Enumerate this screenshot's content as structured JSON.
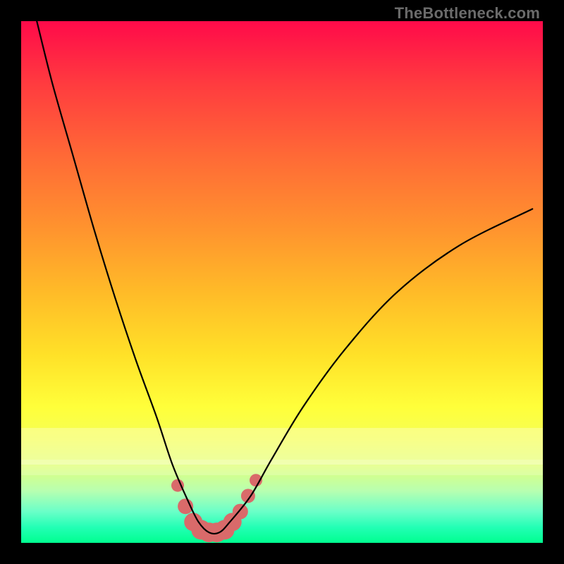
{
  "watermark": "TheBottleneck.com",
  "chart_data": {
    "type": "line",
    "title": "",
    "xlabel": "",
    "ylabel": "",
    "xlim": [
      0,
      100
    ],
    "ylim": [
      0,
      100
    ],
    "series": [
      {
        "name": "bottleneck-curve",
        "x": [
          3,
          6,
          10,
          14,
          18,
          22,
          26,
          29,
          32,
          34,
          36,
          38,
          40,
          44,
          48,
          54,
          62,
          72,
          84,
          98
        ],
        "y": [
          100,
          88,
          74,
          60,
          47,
          35,
          24,
          15,
          8,
          4,
          2,
          2,
          4,
          9,
          16,
          26,
          37,
          48,
          57,
          64
        ]
      }
    ],
    "markers": {
      "name": "highlight-points",
      "x": [
        30,
        31.5,
        33,
        34.5,
        36,
        37.5,
        39,
        40.5,
        42,
        43.5,
        45
      ],
      "y": [
        11,
        7,
        4,
        2.5,
        2,
        2,
        2.5,
        4,
        6,
        9,
        12
      ],
      "size": [
        9,
        11,
        13,
        14,
        14,
        14,
        14,
        13,
        11,
        10,
        9
      ]
    }
  }
}
